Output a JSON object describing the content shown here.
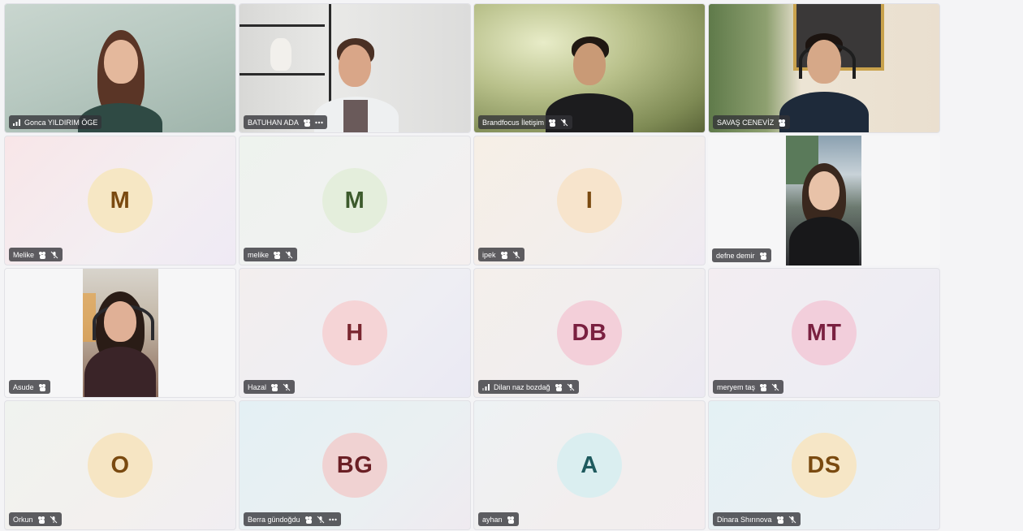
{
  "participants": [
    {
      "name": "Gonca YILDIRIM ÖGE",
      "type": "video",
      "signal": true,
      "raise_hand": false,
      "muted": false,
      "more": false
    },
    {
      "name": "BATUHAN ADA",
      "type": "video",
      "signal": false,
      "raise_hand": true,
      "muted": false,
      "more": true
    },
    {
      "name": "Brandfocus İletişim",
      "type": "video",
      "signal": false,
      "raise_hand": true,
      "muted": true,
      "more": false
    },
    {
      "name": "SAVAŞ CENEVİZ",
      "type": "video",
      "signal": false,
      "raise_hand": true,
      "muted": false,
      "more": false
    },
    {
      "name": "Melike",
      "type": "avatar",
      "initials": "M",
      "avatar_bg": "#f6e7c4",
      "avatar_fg": "#7a4a10",
      "raise_hand": true,
      "muted": true
    },
    {
      "name": "melike",
      "type": "avatar",
      "initials": "M",
      "avatar_bg": "#e4eedc",
      "avatar_fg": "#3c5a2c",
      "raise_hand": true,
      "muted": true
    },
    {
      "name": "ipek",
      "type": "avatar",
      "initials": "I",
      "avatar_bg": "#f7e4cc",
      "avatar_fg": "#7a4a10",
      "raise_hand": true,
      "muted": true
    },
    {
      "name": "defne demir",
      "type": "video",
      "raise_hand": true,
      "muted": false
    },
    {
      "name": "Asude",
      "type": "video",
      "raise_hand": true,
      "muted": false
    },
    {
      "name": "Hazal",
      "type": "avatar",
      "initials": "H",
      "avatar_bg": "#f5d4d6",
      "avatar_fg": "#7a2730",
      "raise_hand": true,
      "muted": true
    },
    {
      "name": "Dilan naz bozdağ",
      "type": "avatar",
      "initials": "DB",
      "avatar_bg": "#f3cfd9",
      "avatar_fg": "#7a2040",
      "signal": true,
      "raise_hand": true,
      "muted": true
    },
    {
      "name": "meryem taş",
      "type": "avatar",
      "initials": "MT",
      "avatar_bg": "#f2cedb",
      "avatar_fg": "#7a2040",
      "raise_hand": true,
      "muted": true
    },
    {
      "name": "Orkun",
      "type": "avatar",
      "initials": "O",
      "avatar_bg": "#f6e5c3",
      "avatar_fg": "#7a4a10",
      "raise_hand": true,
      "muted": true
    },
    {
      "name": "Berra gündoğdu",
      "type": "avatar",
      "initials": "BG",
      "avatar_bg": "#f0d2d2",
      "avatar_fg": "#6b1f25",
      "raise_hand": true,
      "muted": true,
      "more": true
    },
    {
      "name": "ayhan",
      "type": "avatar",
      "initials": "A",
      "avatar_bg": "#daeef0",
      "avatar_fg": "#1e5a5e",
      "raise_hand": true,
      "muted": false
    },
    {
      "name": "Dinara Shırınova",
      "type": "avatar",
      "initials": "DS",
      "avatar_bg": "#f6e6c6",
      "avatar_fg": "#7a4a10",
      "raise_hand": true,
      "muted": true
    }
  ]
}
